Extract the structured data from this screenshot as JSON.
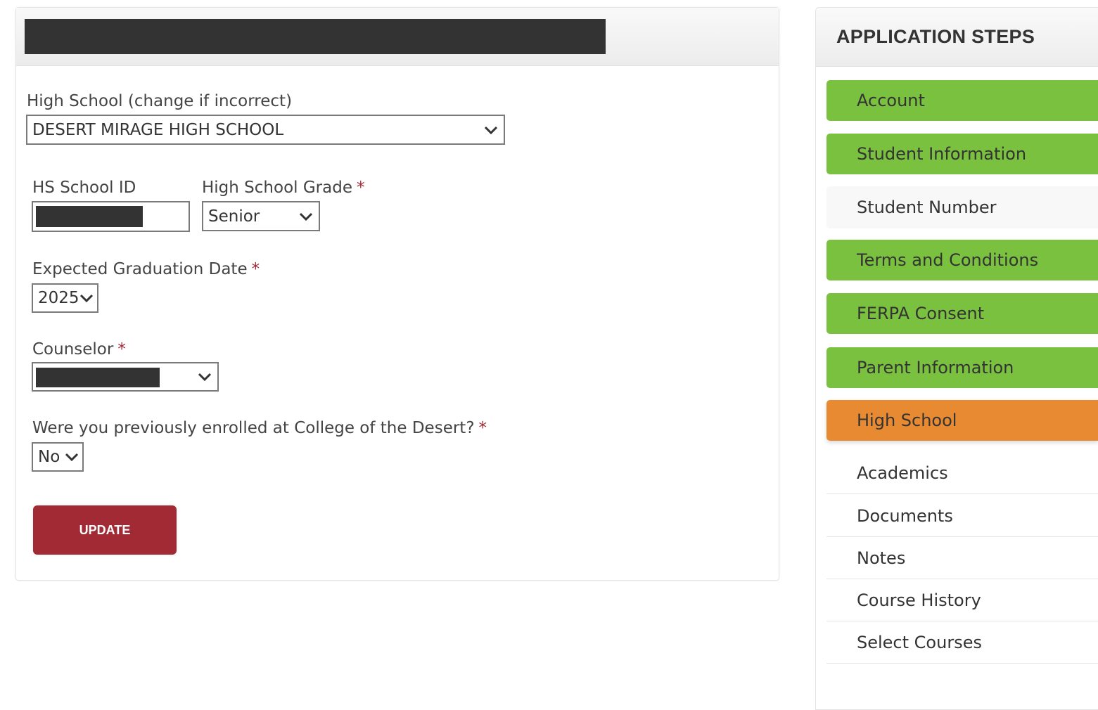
{
  "form": {
    "high_school_label": "High School (change if incorrect)",
    "high_school_value": "DESERT MIRAGE HIGH SCHOOL",
    "hs_school_id_label": "HS School ID",
    "grade_label": "High School Grade",
    "grade_value": "Senior",
    "grad_date_label": "Expected Graduation Date",
    "grad_date_value": "2025",
    "counselor_label": "Counselor",
    "prev_enrolled_label": "Were you previously enrolled at College of the Desert?",
    "prev_enrolled_value": "No",
    "required_mark": "*",
    "update_button": "UPDATE"
  },
  "sidebar": {
    "title": "APPLICATION STEPS",
    "steps": [
      {
        "label": "Account",
        "status": "complete"
      },
      {
        "label": "Student Information",
        "status": "complete"
      },
      {
        "label": "Student Number",
        "status": "neutral"
      },
      {
        "label": "Terms and Conditions",
        "status": "complete"
      },
      {
        "label": "FERPA Consent",
        "status": "complete"
      },
      {
        "label": "Parent Information",
        "status": "complete"
      },
      {
        "label": "High School",
        "status": "current"
      },
      {
        "label": "Academics",
        "status": "pending"
      },
      {
        "label": "Documents",
        "status": "pending"
      },
      {
        "label": "Notes",
        "status": "pending"
      },
      {
        "label": "Course History",
        "status": "pending"
      },
      {
        "label": "Select Courses",
        "status": "pending"
      }
    ]
  },
  "colors": {
    "complete": "#79c13f",
    "current": "#e88a32",
    "accent": "#a12a35",
    "redacted": "#333333"
  },
  "icons": {
    "select_chevron": "chevron-down-icon",
    "required": "asterisk"
  }
}
